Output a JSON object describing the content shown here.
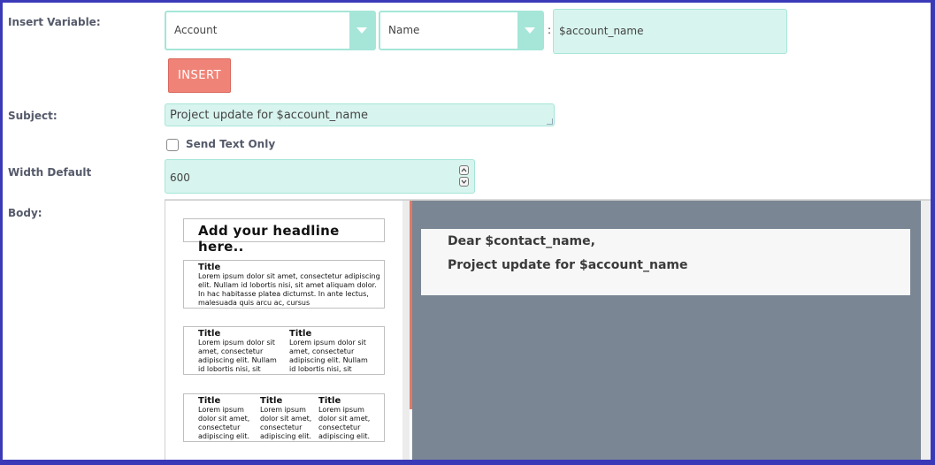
{
  "labels": {
    "insert_variable": "Insert Variable:",
    "subject": "Subject:",
    "width_default": "Width Default",
    "body": "Body:"
  },
  "insert_variable": {
    "module_select": "Account",
    "field_select": "Name",
    "separator": ":",
    "variable_value": "$account_name",
    "insert_button": "INSERT"
  },
  "subject": {
    "value": "Project update for $account_name"
  },
  "send_text_only": {
    "label": "Send Text Only",
    "checked": false
  },
  "width_default": {
    "value": "600"
  },
  "palette": {
    "headline": "Add your headline here..",
    "one_col": {
      "title": "Title",
      "text": "Lorem ipsum dolor sit amet, consectetur adipiscing elit. Nullam id lobortis nisi, sit amet aliquam dolor. In hac habitasse platea dictumst. In ante lectus, malesuada quis arcu ac, cursus"
    },
    "two_col": [
      {
        "title": "Title",
        "text": "Lorem ipsum dolor sit amet, consectetur adipiscing elit. Nullam id lobortis nisi, sit"
      },
      {
        "title": "Title",
        "text": "Lorem ipsum dolor sit amet, consectetur adipiscing elit. Nullam id lobortis nisi, sit"
      }
    ],
    "three_col": [
      {
        "title": "Title",
        "text": "Lorem ipsum dolor sit amet, consectetur adipiscing elit."
      },
      {
        "title": "Title",
        "text": "Lorem ipsum dolor sit amet, consectetur adipiscing elit."
      },
      {
        "title": "Title",
        "text": "Lorem ipsum dolor sit amet, consectetur adipiscing elit."
      }
    ]
  },
  "body_content": {
    "line1": "Dear $contact_name,",
    "line2": "Project update for $account_name"
  },
  "colors": {
    "accent_mint": "#a5e6d8",
    "field_bg": "#d8f4ee",
    "insert_button": "#f08377",
    "canvas_bg": "#7a8694"
  }
}
